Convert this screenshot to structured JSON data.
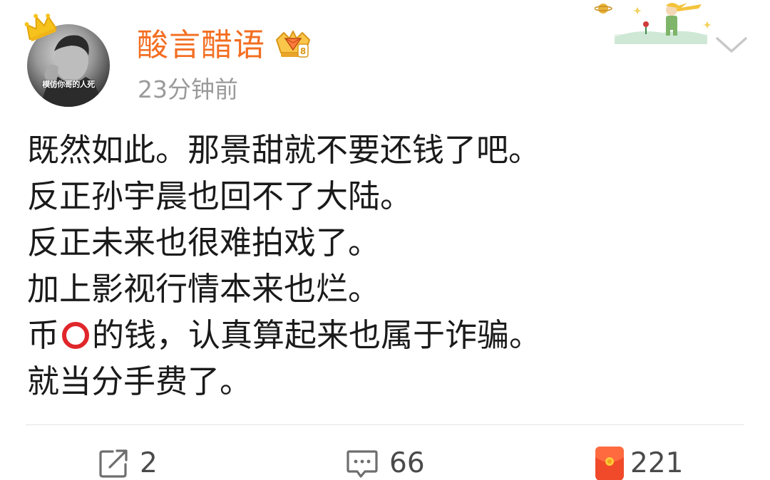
{
  "header": {
    "username": "酸言醋语",
    "timestamp": "23分钟前",
    "avatar_caption": "模仿你哥的人死",
    "colors": {
      "username": "#f36e21",
      "timestamp": "#9a9a9a"
    }
  },
  "icons": {
    "crown": "crown-icon",
    "vip_badge": "vip-crown-badge-icon",
    "menu": "chevron-down-icon",
    "repost": "repost-icon",
    "comment": "comment-icon",
    "like": "red-envelope-like-icon"
  },
  "post": {
    "lines": [
      "既然如此。那景甜就不要还钱了吧。",
      "反正孙宇晨也回不了大陆。",
      "反正未来也很难拍戏了。",
      "加上影视行情本来也烂。",
      "就当分手费了。"
    ],
    "line5_before": "币",
    "line5_after": "的钱，认真算起来也属于诈骗。"
  },
  "actions": {
    "repost_count": "2",
    "comment_count": "66",
    "like_count": "221"
  }
}
